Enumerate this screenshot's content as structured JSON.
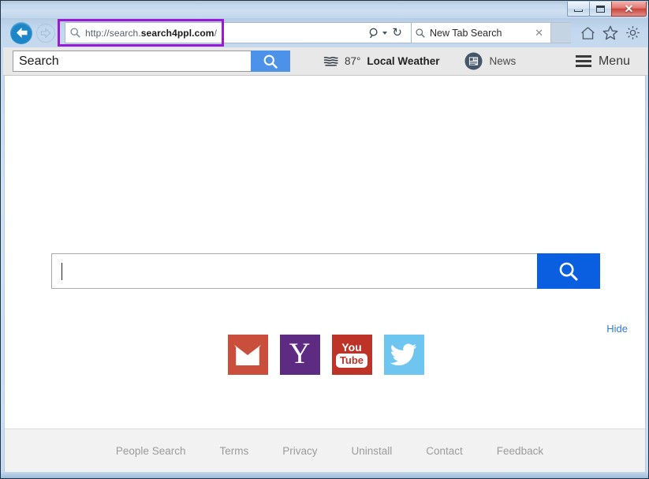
{
  "window": {
    "controls": {
      "minimize_label": "Minimize",
      "maximize_label": "Maximize",
      "close_label": "✕"
    }
  },
  "browser": {
    "back_label": "Back",
    "forward_label": "Forward",
    "address": {
      "full_url": "http://search.search4ppl.com/",
      "prefix": "http://search.",
      "domain": "search4ppl.com",
      "suffix": "/",
      "search_icon": "search-icon",
      "dropdown_icon": "chevron-down-icon",
      "refresh_icon": "refresh-icon",
      "refresh_glyph": "↻"
    },
    "search_tab": {
      "label": "New Tab Search",
      "close_glyph": "✕",
      "icon": "search-icon"
    },
    "nav_icons": [
      {
        "name": "home-icon",
        "label": "Home"
      },
      {
        "name": "favorites-star-icon",
        "label": "Favorites"
      },
      {
        "name": "settings-gear-icon",
        "label": "Tools"
      }
    ],
    "annotation": {
      "name": "address-bar-highlight",
      "color": "#9b18d6"
    }
  },
  "toolbar": {
    "search_placeholder": "Search",
    "search_button_icon": "search-icon",
    "weather": {
      "icon": "fog-waves-icon",
      "temperature": "87°",
      "label": "Local Weather"
    },
    "news": {
      "icon": "newspaper-icon",
      "label": "News"
    },
    "menu": {
      "icon": "hamburger-menu-icon",
      "label": "Menu"
    }
  },
  "page": {
    "search": {
      "value": "",
      "placeholder": "",
      "button_icon": "search-icon"
    },
    "hide_label": "Hide",
    "shortcuts": [
      {
        "name": "gmail",
        "label": "Gmail",
        "color": "#c94f3c"
      },
      {
        "name": "yahoo",
        "label": "Y",
        "color": "#5d2c82"
      },
      {
        "name": "youtube",
        "label_top": "You",
        "label_bottom": "Tube",
        "color": "#bd3327"
      },
      {
        "name": "twitter",
        "label": "Twitter",
        "color": "#6ec6f0"
      }
    ],
    "footer_links": [
      {
        "label": "People Search"
      },
      {
        "label": "Terms"
      },
      {
        "label": "Privacy"
      },
      {
        "label": "Uninstall"
      },
      {
        "label": "Contact"
      },
      {
        "label": "Feedback"
      }
    ]
  },
  "colors": {
    "toolbar_bg": "#e8e8e8",
    "toolbar_search_btn": "#4b92e8",
    "page_search_btn": "#0a5fe0",
    "hide_link": "#2f7bd1",
    "footer_link": "#9b9b9b",
    "titlebar": "#c3d8ee"
  }
}
